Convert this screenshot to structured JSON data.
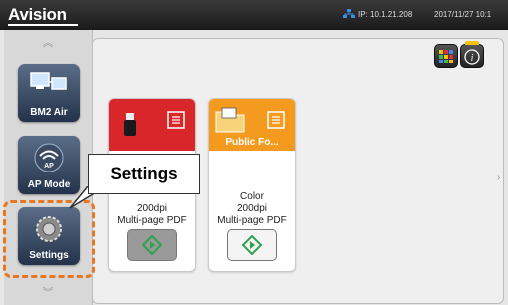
{
  "header": {
    "logo": "Avision",
    "ip": "IP: 10.1.21.208",
    "datetime": "2017/11/27 10:1"
  },
  "sidebar": {
    "items": [
      {
        "label": "BM2 Air"
      },
      {
        "label": "AP Mode"
      },
      {
        "label": "Settings"
      }
    ]
  },
  "cards": [
    {
      "title": "",
      "color": "#d8262b",
      "line1": "",
      "line2": "200dpi",
      "line3": "Multi-page PDF"
    },
    {
      "title": "Public Fo...",
      "color": "#f39a1f",
      "line1": "Color",
      "line2": "200dpi",
      "line3": "Multi-page PDF"
    }
  ],
  "callout": {
    "text": "Settings"
  },
  "colors": {
    "highlight": "#e87722",
    "go_icon": "#2fa24d"
  }
}
